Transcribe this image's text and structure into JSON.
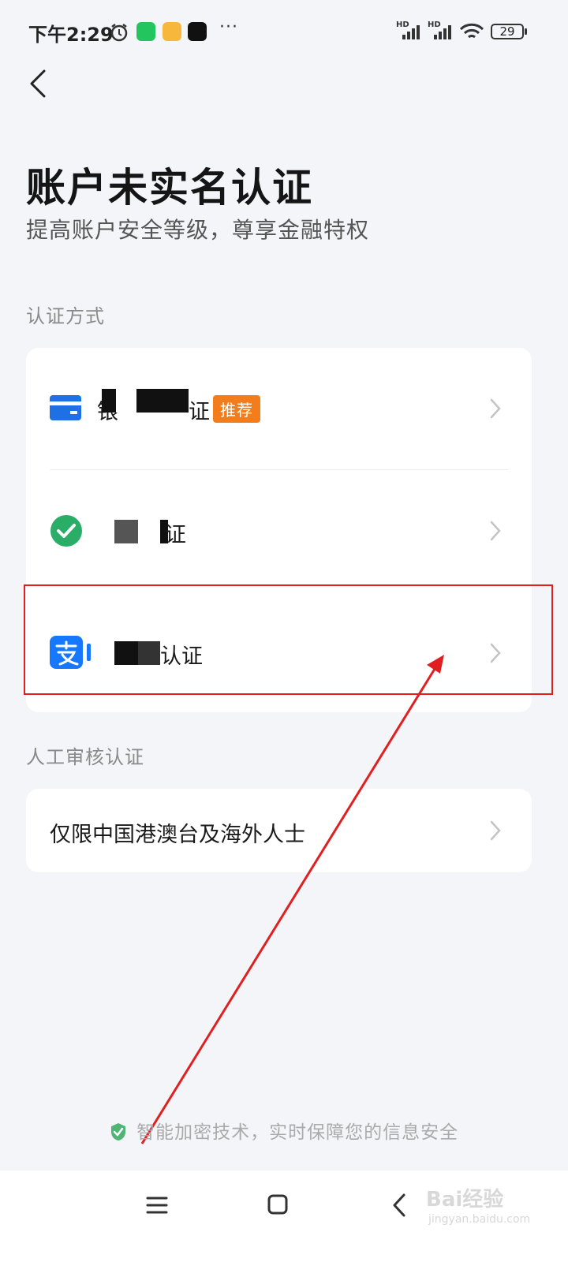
{
  "status_bar": {
    "time": "下午2:29",
    "more": "···",
    "network1": "HD",
    "network2": "HD",
    "battery": "29"
  },
  "page": {
    "title": "账户未实名认证",
    "subtitle": "提高账户安全等级，尊享金融特权"
  },
  "methods_section": {
    "label": "认证方式",
    "items": [
      {
        "label_start": "银",
        "label_end": "证",
        "badge": "推荐",
        "icon": "bank-card-icon"
      },
      {
        "label_end": "证",
        "icon": "wechat-icon"
      },
      {
        "label_end": "认证",
        "icon": "alipay-icon"
      }
    ]
  },
  "manual_section": {
    "label": "人工审核认证",
    "items": [
      {
        "label": "仅限中国港澳台及海外人士"
      }
    ]
  },
  "footer": {
    "security_note": "智能加密技术，实时保障您的信息安全"
  },
  "watermark": {
    "brand": "Bai经验",
    "url": "jingyan.baidu.com"
  },
  "colors": {
    "accent_orange": "#f37d1a",
    "alipay_blue": "#1677ff",
    "wechat_green": "#2aae67",
    "highlight_red": "#e02020"
  }
}
